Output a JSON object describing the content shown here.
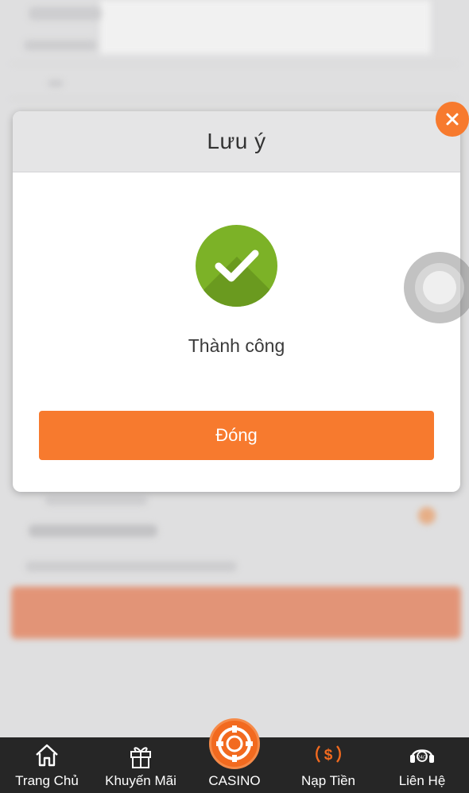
{
  "dialog": {
    "title": "Lưu ý",
    "message": "Thành công",
    "close_label": "Đóng"
  },
  "bottom_nav": {
    "items": [
      {
        "label": "Trang Chủ",
        "icon": "home-icon"
      },
      {
        "label": "Khuyến Mãi",
        "icon": "gift-icon"
      },
      {
        "label": "CASINO",
        "icon": "casino-chip-icon"
      },
      {
        "label": "Nạp Tiền",
        "icon": "deposit-dollar-icon"
      },
      {
        "label": "Liên Hệ",
        "icon": "support-headset-icon"
      }
    ]
  },
  "colors": {
    "accent": "#f77a2e",
    "success": "#7cb227",
    "nav_bg": "#262626",
    "header_bg": "#e5e5e6"
  }
}
